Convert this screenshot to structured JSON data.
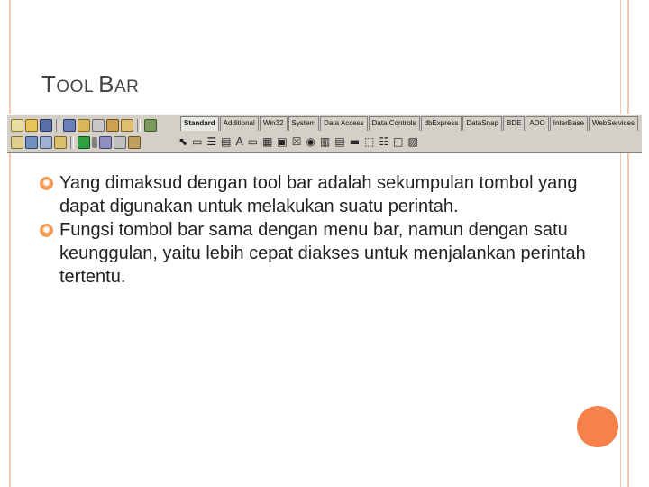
{
  "slide": {
    "title_first": "T",
    "title_rest": "OOL",
    "title_space": " ",
    "title_second": "B",
    "title_second_rest": "AR"
  },
  "toolbar_image": {
    "tabs": [
      "Standard",
      "Additional",
      "Win32",
      "System",
      "Data Access",
      "Data Controls",
      "dbExpress",
      "DataSnap",
      "BDE",
      "ADO",
      "InterBase",
      "WebServices"
    ]
  },
  "bullets": [
    {
      "icon": "sun-bullet-icon",
      "text": "Yang dimaksud dengan tool bar adalah sekumpulan tombol yang dapat digunakan untuk melakukan suatu perintah."
    },
    {
      "icon": "sun-bullet-icon",
      "text": "Fungsi tombol bar sama dengan menu bar, namun dengan satu keunggulan, yaitu lebih cepat diakses untuk menjalankan perintah tertentu."
    }
  ],
  "colors": {
    "accent": "#f5824a",
    "frame": "#f2c7b3",
    "bullet": "#f59a55"
  }
}
